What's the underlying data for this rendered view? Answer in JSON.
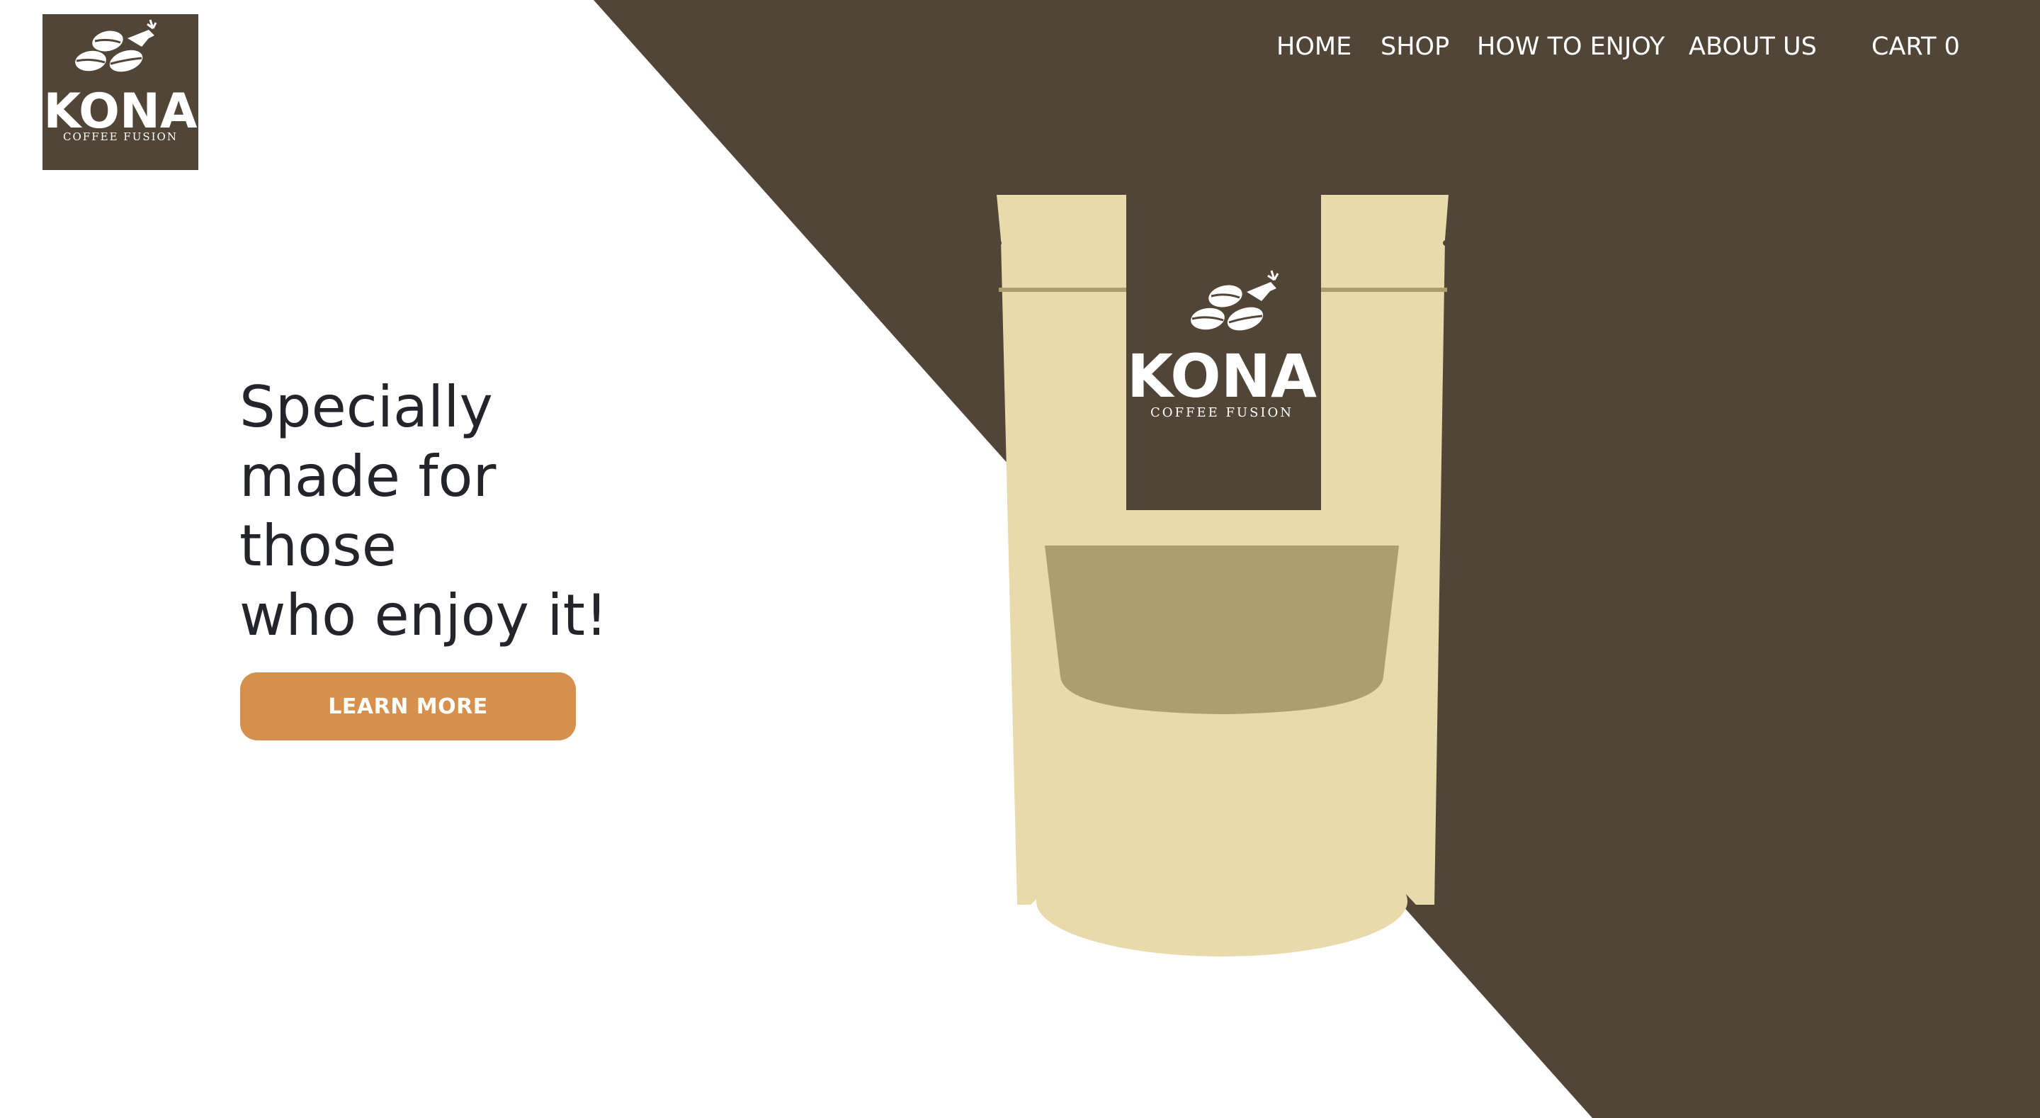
{
  "brand": {
    "name": "KONA",
    "tagline": "COFFEE FUSION"
  },
  "nav": {
    "items": [
      {
        "label": "HOME"
      },
      {
        "label": "SHOP"
      },
      {
        "label": "HOW TO ENJOY"
      },
      {
        "label": "ABOUT US"
      }
    ],
    "cart_label": "CART 0"
  },
  "hero": {
    "headline_lines": [
      "Specially",
      "made for",
      "those",
      "who enjoy it!"
    ],
    "cta_label": "LEARN MORE"
  },
  "product": {
    "bag_label_name": "KONA",
    "bag_label_tagline": "COFFEE FUSION"
  },
  "colors": {
    "brand_brown": "#514537",
    "bag_kraft": "#e8daaa",
    "bag_window": "#ae9e6e",
    "accent_orange": "#d6904b",
    "headline_text": "#23252b",
    "background": "#ffffff"
  },
  "icons": {
    "logo_mark": "coffee-beans-bird-icon"
  }
}
